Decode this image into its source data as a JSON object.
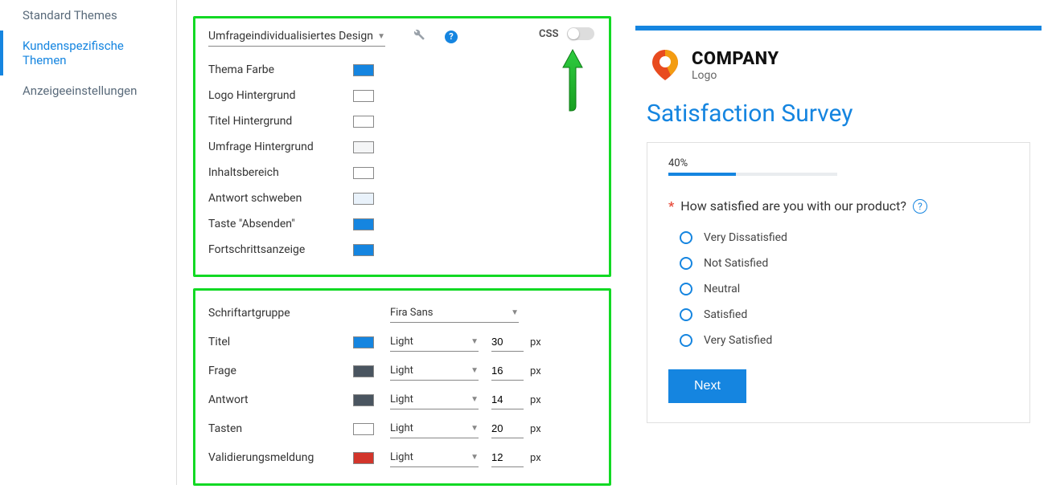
{
  "sidebar": {
    "items": [
      {
        "label": "Standard Themes"
      },
      {
        "label": "Kundenspezifische Themen"
      },
      {
        "label": "Anzeigeeinstellungen"
      }
    ],
    "active_index": 1
  },
  "design_panel": {
    "select_label": "Umfrageindividualisiertes Design",
    "rows": [
      {
        "label": "Thema Farbe",
        "color": "#1585e0"
      },
      {
        "label": "Logo Hintergrund",
        "color": "#ffffff"
      },
      {
        "label": "Titel Hintergrund",
        "color": "#ffffff"
      },
      {
        "label": "Umfrage Hintergrund",
        "color": "#f4f5f6"
      },
      {
        "label": "Inhaltsbereich",
        "color": "#ffffff"
      },
      {
        "label": "Antwort schweben",
        "color": "#e9f2fb"
      },
      {
        "label": "Taste \"Absenden\"",
        "color": "#1585e0"
      },
      {
        "label": "Fortschrittsanzeige",
        "color": "#1585e0"
      }
    ]
  },
  "font_panel": {
    "group_label": "Schriftartgruppe",
    "group_value": "Fira Sans",
    "unit": "px",
    "rows": [
      {
        "label": "Titel",
        "color": "#1585e0",
        "weight": "Light",
        "size": "30"
      },
      {
        "label": "Frage",
        "color": "#4a5560",
        "weight": "Light",
        "size": "16"
      },
      {
        "label": "Antwort",
        "color": "#4a5560",
        "weight": "Light",
        "size": "14"
      },
      {
        "label": "Tasten",
        "color": "#ffffff",
        "weight": "Light",
        "size": "20"
      },
      {
        "label": "Validierungsmeldung",
        "color": "#d2352b",
        "weight": "Light",
        "size": "12"
      }
    ]
  },
  "css_toggle": {
    "label": "CSS",
    "on": false
  },
  "preview": {
    "company_line1": "COMPANY",
    "company_line2": "Logo",
    "title": "Satisfaction Survey",
    "progress_label": "40%",
    "progress_value": 40,
    "question": "How satisfied are you with our product?",
    "options": [
      "Very Dissatisfied",
      "Not Satisfied",
      "Neutral",
      "Satisfied",
      "Very Satisfied"
    ],
    "next_label": "Next"
  }
}
